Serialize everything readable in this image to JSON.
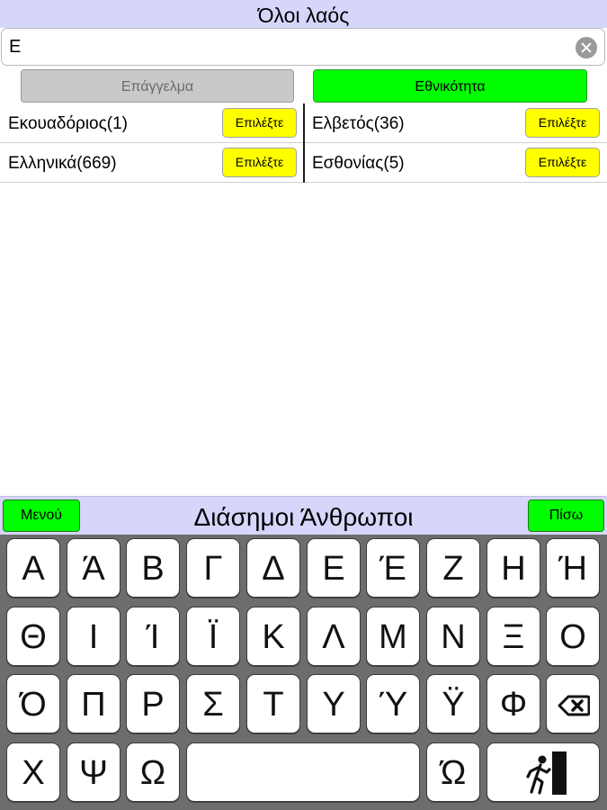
{
  "header": {
    "title": "Όλοι λαός"
  },
  "search": {
    "value": "Ε"
  },
  "tabs": [
    {
      "label": "Επάγγελμα",
      "active": false
    },
    {
      "label": "Εθνικότητα",
      "active": true
    }
  ],
  "results": {
    "select_label": "Επιλέξτε",
    "items": [
      {
        "label": "Εκουαδόριος(1)"
      },
      {
        "label": "Ελβετός(36)"
      },
      {
        "label": "Ελληνικά(669)"
      },
      {
        "label": "Εσθονίας(5)"
      }
    ]
  },
  "bottom_bar": {
    "title": "Διάσημοι Άνθρωποι",
    "menu_label": "Μενού",
    "back_label": "Πίσω"
  },
  "keyboard": {
    "rows": [
      [
        "Α",
        "Ά",
        "Β",
        "Γ",
        "Δ",
        "Ε",
        "Έ",
        "Ζ",
        "Η",
        "Ή"
      ],
      [
        "Θ",
        "Ι",
        "Ί",
        "Ϊ",
        "Κ",
        "Λ",
        "Μ",
        "Ν",
        "Ξ",
        "Ο"
      ],
      [
        "Ό",
        "Π",
        "Ρ",
        "Σ",
        "Τ",
        "Υ",
        "Ύ",
        "Ϋ",
        "Φ"
      ],
      [
        "Χ",
        "Ψ",
        "Ω",
        "Ώ"
      ]
    ],
    "icons": {
      "backspace": "backspace-icon",
      "exit": "exit-icon"
    }
  },
  "colors": {
    "header_bg": "#d6d6fb",
    "active_tab": "#00ff00",
    "select_button": "#ffff00",
    "keyboard_bg": "#6d6d6d"
  }
}
